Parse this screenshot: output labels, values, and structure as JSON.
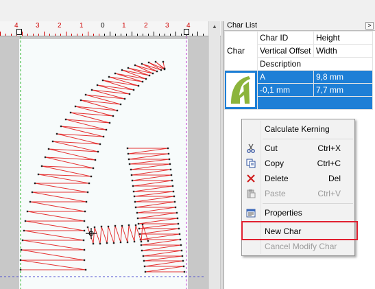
{
  "ruler": {
    "labels": [
      "4",
      "3",
      "2",
      "1",
      "0",
      "1",
      "2",
      "3",
      "4"
    ],
    "marker": "4"
  },
  "panel": {
    "title": "Char List",
    "collapse_icon": "chevron-right-icon",
    "collapse_glyph": ">"
  },
  "table": {
    "header_row1": {
      "col_char": "Char",
      "col_id": "Char ID",
      "col_height": "Height"
    },
    "header_row2": {
      "col_voffset": "Vertical Offset",
      "col_width": "Width"
    },
    "header_row3": {
      "col_desc": "Description"
    },
    "rows": [
      {
        "char_id": "A",
        "height": "9,8 mm",
        "vertical_offset": "-0,1 mm",
        "width": "7,7 mm",
        "description": ""
      }
    ]
  },
  "context_menu": {
    "items": [
      {
        "label": "Calculate Kerning",
        "shortcut": "",
        "icon": "",
        "enabled": true
      },
      {
        "label": "Cut",
        "shortcut": "Ctrl+X",
        "icon": "scissors-icon",
        "enabled": true
      },
      {
        "label": "Copy",
        "shortcut": "Ctrl+C",
        "icon": "copy-icon",
        "enabled": true
      },
      {
        "label": "Delete",
        "shortcut": "Del",
        "icon": "delete-x-icon",
        "enabled": true
      },
      {
        "label": "Paste",
        "shortcut": "Ctrl+V",
        "icon": "paste-icon",
        "enabled": false
      },
      {
        "label": "Properties",
        "shortcut": "",
        "icon": "properties-icon",
        "enabled": true
      },
      {
        "label": "New Char",
        "shortcut": "",
        "icon": "",
        "enabled": true,
        "highlighted": true
      },
      {
        "label": "Cancel Modify Char",
        "shortcut": "",
        "icon": "",
        "enabled": false
      }
    ]
  },
  "colors": {
    "stitch": "#e53030",
    "selection": "#1e7fd6",
    "highlight_box": "#e02030",
    "thumb_letter": "#8cb43c"
  }
}
